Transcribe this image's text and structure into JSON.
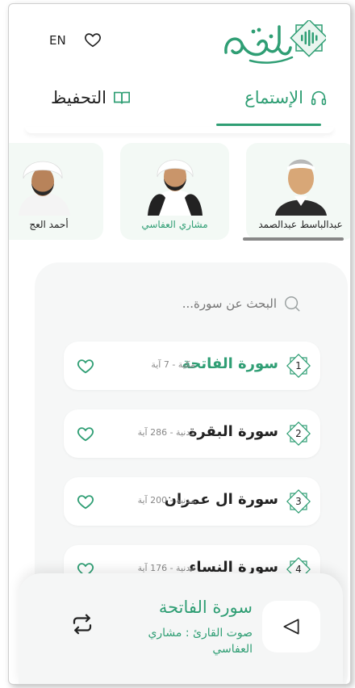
{
  "header": {
    "lang_toggle": "EN",
    "brand_color": "#2f9e74"
  },
  "tabs": [
    {
      "label": "الإستماع",
      "icon": "headphones-icon",
      "active": true
    },
    {
      "label": "التحفيظ",
      "icon": "book-icon",
      "active": false
    }
  ],
  "reciters": [
    {
      "name": "عبدالباسط عبدالصمد",
      "selected": false
    },
    {
      "name": "مشاري العفاسي",
      "selected": true
    },
    {
      "name": "أحمد العج",
      "selected": false
    }
  ],
  "search": {
    "placeholder": "البحث عن سورة..."
  },
  "surahs": [
    {
      "number": "1",
      "name": "سورة الفاتحة",
      "meta": "مكية - 7 آية",
      "selected": true
    },
    {
      "number": "2",
      "name": "سورة البقرة",
      "meta": "مدنية - 286 آية",
      "selected": false
    },
    {
      "number": "3",
      "name": "سورة ال عمران",
      "meta": "مدنية - 200 آية",
      "selected": false
    },
    {
      "number": "4",
      "name": "سورة النساء",
      "meta": "مدنية - 176 آية",
      "selected": false
    }
  ],
  "player": {
    "title": "سورة الفاتحة",
    "reciter": "صوت القارئ : مشاري العفاسي"
  }
}
